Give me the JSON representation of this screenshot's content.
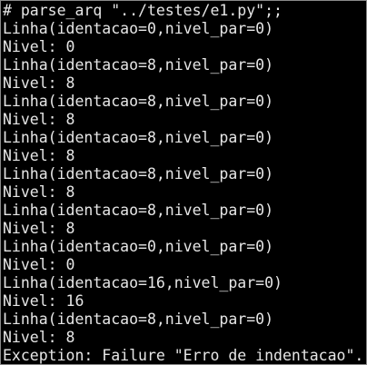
{
  "terminal": {
    "lines": [
      "# parse_arq \"../testes/e1.py\";;",
      "Linha(identacao=0,nivel_par=0)",
      "Nivel: 0",
      "Linha(identacao=8,nivel_par=0)",
      "Nivel: 8",
      "Linha(identacao=8,nivel_par=0)",
      "Nivel: 8",
      "Linha(identacao=8,nivel_par=0)",
      "Nivel: 8",
      "Linha(identacao=8,nivel_par=0)",
      "Nivel: 8",
      "Linha(identacao=8,nivel_par=0)",
      "Nivel: 8",
      "Linha(identacao=0,nivel_par=0)",
      "Nivel: 0",
      "Linha(identacao=16,nivel_par=0)",
      "Nivel: 16",
      "Linha(identacao=8,nivel_par=0)",
      "Nivel: 8",
      "Exception: Failure \"Erro de indentacao\"."
    ],
    "colors": {
      "background": "#000000",
      "foreground": "#e6e6e6",
      "border": "#8a8a8a"
    }
  }
}
